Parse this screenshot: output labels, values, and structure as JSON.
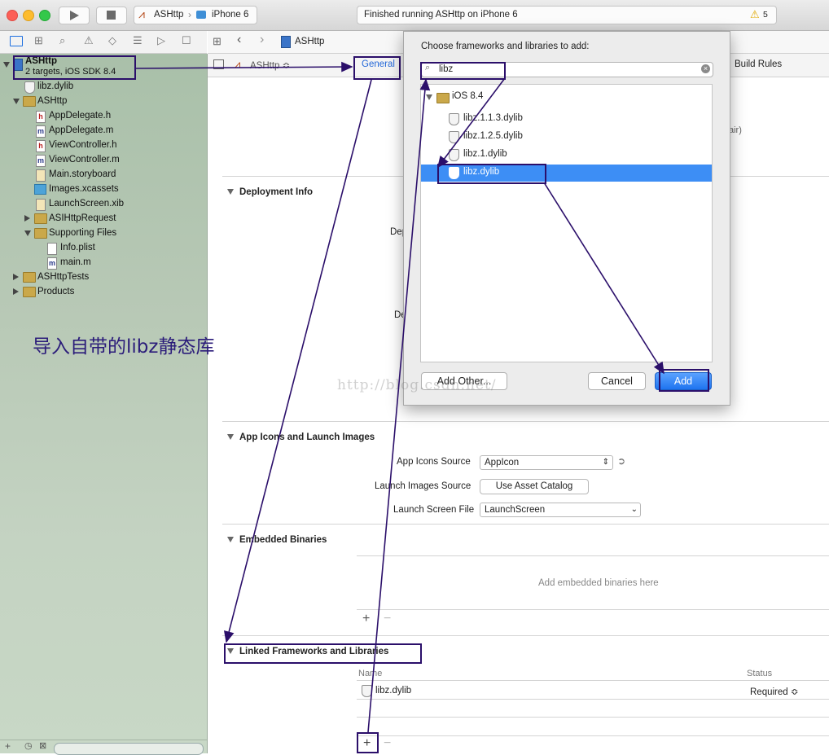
{
  "toolbar": {
    "scheme": "ASHttp",
    "device": "iPhone 6",
    "status": "Finished running ASHttp on iPhone 6",
    "warning_count": "5"
  },
  "navigator": {
    "project": {
      "name": "ASHttp",
      "subtitle": "2 targets, iOS SDK 8.4"
    },
    "items": [
      {
        "label": "libz.dylib",
        "icon": "dylib-icon"
      },
      {
        "label": "ASHttp",
        "icon": "folder-icon"
      },
      {
        "label": "AppDelegate.h",
        "icon": "header-file-icon",
        "glyph": "h"
      },
      {
        "label": "AppDelegate.m",
        "icon": "source-file-icon",
        "glyph": "m"
      },
      {
        "label": "ViewController.h",
        "icon": "header-file-icon",
        "glyph": "h"
      },
      {
        "label": "ViewController.m",
        "icon": "source-file-icon",
        "glyph": "m"
      },
      {
        "label": "Main.storyboard",
        "icon": "storyboard-icon"
      },
      {
        "label": "Images.xcassets",
        "icon": "assets-icon"
      },
      {
        "label": "LaunchScreen.xib",
        "icon": "xib-icon"
      },
      {
        "label": "ASIHttpRequest",
        "icon": "folder-icon"
      },
      {
        "label": "Supporting Files",
        "icon": "folder-icon"
      },
      {
        "label": "Info.plist",
        "icon": "plist-icon"
      },
      {
        "label": "main.m",
        "icon": "source-file-icon",
        "glyph": "m"
      },
      {
        "label": "ASHttpTests",
        "icon": "folder-icon"
      },
      {
        "label": "Products",
        "icon": "folder-icon"
      }
    ],
    "annotation": "导入自带的libz静态库"
  },
  "editor": {
    "jump_title": "ASHttp",
    "target": "ASHttp ≎",
    "tab_general": "General",
    "tab_build_rules": "Build Rules",
    "hidden_fragment_pair": "air)",
    "sections": {
      "deployment": "Deployment Info",
      "dep_label_1": "Dep",
      "dep_label_2": "De",
      "app_icons": "App Icons and Launch Images",
      "app_icons_source_label": "App Icons Source",
      "app_icons_source_value": "AppIcon",
      "launch_images_label": "Launch Images Source",
      "launch_images_button": "Use Asset Catalog",
      "launch_screen_label": "Launch Screen File",
      "launch_screen_value": "LaunchScreen",
      "embedded": "Embedded Binaries",
      "embedded_placeholder": "Add embedded binaries here",
      "linked": "Linked Frameworks and Libraries",
      "col_name": "Name",
      "col_status": "Status",
      "linked_item": "libz.dylib",
      "linked_status": "Required ≎"
    }
  },
  "sheet": {
    "title": "Choose frameworks and libraries to add:",
    "search_value": "libz",
    "group": "iOS 8.4",
    "items": [
      "libz.1.1.3.dylib",
      "libz.1.2.5.dylib",
      "libz.1.dylib",
      "libz.dylib"
    ],
    "selected_index": 3,
    "add_other": "Add Other...",
    "cancel": "Cancel",
    "add": "Add"
  },
  "watermark": "http://blog.csdn.net/",
  "colors": {
    "annotation": "#2b0f6a",
    "selection": "#3d8ef5",
    "add_button": "#1e74f0"
  }
}
